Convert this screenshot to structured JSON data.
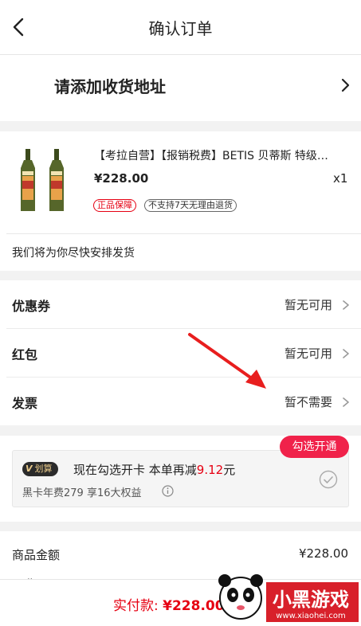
{
  "header": {
    "title": "确认订单"
  },
  "address": {
    "prompt": "请添加收货地址"
  },
  "product": {
    "title": "【考拉自营】【报销税费】BETIS 贝蒂斯 特级…",
    "price": "¥228.00",
    "quantity": "x1",
    "tags": [
      "正品保障",
      "不支持7天无理由退货"
    ],
    "shipping_note": "我们将为你尽快安排发货"
  },
  "options": [
    {
      "label": "优惠券",
      "value": "暂无可用"
    },
    {
      "label": "红包",
      "value": "暂无可用"
    },
    {
      "label": "发票",
      "value": "暂不需要"
    }
  ],
  "black_card": {
    "badge": "划算",
    "badge_letter": "V",
    "main_text": "现在勾选开卡 本单再减",
    "discount": "9.12",
    "unit": "元",
    "sub_text": "黑卡年费279 享16大权益",
    "open_button": "勾选开通"
  },
  "summary": {
    "goods_label": "商品金额",
    "goods_value": "¥228.00",
    "shipping_label": "运费"
  },
  "bottom": {
    "pay_label": "实付款:",
    "pay_amount": "¥228.00"
  },
  "colors": {
    "accent": "#e60012",
    "button": "#f0224a",
    "annotation_arrow": "#e81e1e"
  },
  "watermark": {
    "brand": "小黑游戏",
    "url": "www.xiaohei.com"
  }
}
